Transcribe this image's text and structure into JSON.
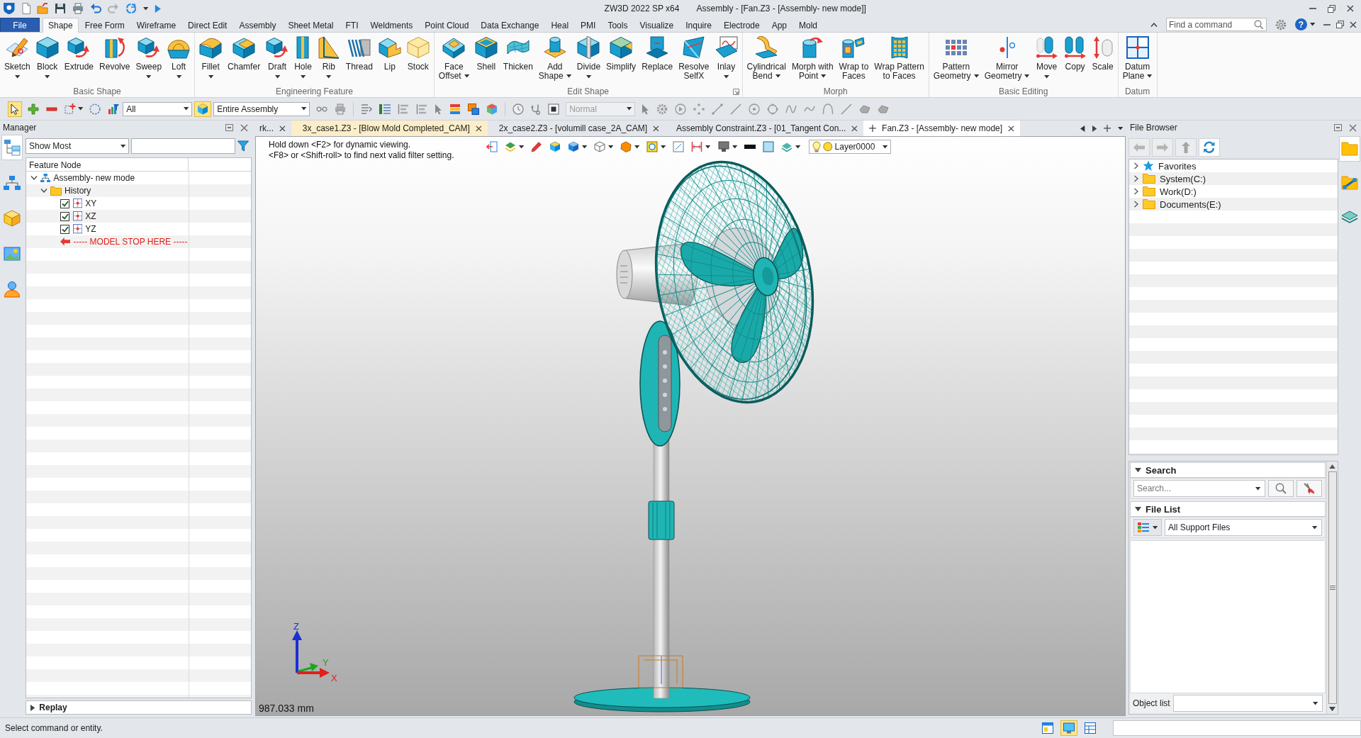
{
  "title_bar": {
    "app_name": "ZW3D 2022 SP x64",
    "document_title": "Assembly - [Fan.Z3 - [Assembly- new mode]]"
  },
  "menu_tabs": [
    {
      "label": "File",
      "kind": "file",
      "selected": false
    },
    {
      "label": "Shape",
      "kind": "tab",
      "selected": true
    },
    {
      "label": "Free Form",
      "kind": "tab",
      "selected": false
    },
    {
      "label": "Wireframe",
      "kind": "tab",
      "selected": false
    },
    {
      "label": "Direct Edit",
      "kind": "tab",
      "selected": false
    },
    {
      "label": "Assembly",
      "kind": "tab",
      "selected": false
    },
    {
      "label": "Sheet Metal",
      "kind": "tab",
      "selected": false
    },
    {
      "label": "FTI",
      "kind": "tab",
      "selected": false
    },
    {
      "label": "Weldments",
      "kind": "tab",
      "selected": false
    },
    {
      "label": "Point Cloud",
      "kind": "tab",
      "selected": false
    },
    {
      "label": "Data Exchange",
      "kind": "tab",
      "selected": false
    },
    {
      "label": "Heal",
      "kind": "tab",
      "selected": false
    },
    {
      "label": "PMI",
      "kind": "tab",
      "selected": false
    },
    {
      "label": "Tools",
      "kind": "tab",
      "selected": false
    },
    {
      "label": "Visualize",
      "kind": "tab",
      "selected": false
    },
    {
      "label": "Inquire",
      "kind": "tab",
      "selected": false
    },
    {
      "label": "Electrode",
      "kind": "tab",
      "selected": false
    },
    {
      "label": "App",
      "kind": "tab",
      "selected": false
    },
    {
      "label": "Mold",
      "kind": "tab",
      "selected": false
    }
  ],
  "command_search": {
    "placeholder": "Find a command"
  },
  "help_button": {
    "symbol": "?"
  },
  "ribbon_groups": [
    {
      "title": "Basic Shape",
      "launcher": false,
      "buttons": [
        {
          "lines": [
            "Sketch"
          ],
          "dropdown": true
        },
        {
          "lines": [
            "Block"
          ],
          "dropdown": true
        },
        {
          "lines": [
            "Extrude"
          ],
          "dropdown": false
        },
        {
          "lines": [
            "Revolve"
          ],
          "dropdown": false
        },
        {
          "lines": [
            "Sweep"
          ],
          "dropdown": true
        },
        {
          "lines": [
            "Loft"
          ],
          "dropdown": true
        }
      ]
    },
    {
      "title": "Engineering Feature",
      "launcher": false,
      "buttons": [
        {
          "lines": [
            "Fillet"
          ],
          "dropdown": true
        },
        {
          "lines": [
            "Chamfer"
          ],
          "dropdown": false
        },
        {
          "lines": [
            "Draft"
          ],
          "dropdown": true
        },
        {
          "lines": [
            "Hole"
          ],
          "dropdown": true
        },
        {
          "lines": [
            "Rib"
          ],
          "dropdown": true
        },
        {
          "lines": [
            "Thread"
          ],
          "dropdown": false
        },
        {
          "lines": [
            "Lip"
          ],
          "dropdown": false
        },
        {
          "lines": [
            "Stock"
          ],
          "dropdown": false
        }
      ]
    },
    {
      "title": "Edit Shape",
      "launcher": true,
      "buttons": [
        {
          "lines": [
            "Face",
            "Offset"
          ],
          "dropdown": true
        },
        {
          "lines": [
            "Shell"
          ],
          "dropdown": false
        },
        {
          "lines": [
            "Thicken"
          ],
          "dropdown": false
        },
        {
          "lines": [
            "Add",
            "Shape"
          ],
          "dropdown": true
        },
        {
          "lines": [
            "Divide"
          ],
          "dropdown": true
        },
        {
          "lines": [
            "Simplify"
          ],
          "dropdown": false
        },
        {
          "lines": [
            "Replace"
          ],
          "dropdown": false
        },
        {
          "lines": [
            "Resolve",
            "SelfX"
          ],
          "dropdown": false
        },
        {
          "lines": [
            "Inlay"
          ],
          "dropdown": true
        }
      ]
    },
    {
      "title": "Morph",
      "launcher": false,
      "buttons": [
        {
          "lines": [
            "Cylindrical",
            "Bend"
          ],
          "dropdown": true
        },
        {
          "lines": [
            "Morph with",
            "Point"
          ],
          "dropdown": true
        },
        {
          "lines": [
            "Wrap to",
            "Faces"
          ],
          "dropdown": false
        },
        {
          "lines": [
            "Wrap Pattern",
            "to Faces"
          ],
          "dropdown": false
        }
      ]
    },
    {
      "title": "Basic Editing",
      "launcher": false,
      "buttons": [
        {
          "lines": [
            "Pattern",
            "Geometry"
          ],
          "dropdown": true
        },
        {
          "lines": [
            "Mirror",
            "Geometry"
          ],
          "dropdown": true
        },
        {
          "lines": [
            "Move"
          ],
          "dropdown": true
        },
        {
          "lines": [
            "Copy"
          ],
          "dropdown": false
        },
        {
          "lines": [
            "Scale"
          ],
          "dropdown": false
        }
      ]
    },
    {
      "title": "Datum",
      "launcher": false,
      "buttons": [
        {
          "lines": [
            "Datum",
            "Plane"
          ],
          "dropdown": true
        }
      ]
    }
  ],
  "toolbar": {
    "select_active": true,
    "assembly_filter_active": true,
    "selection_filter": "All",
    "scope": "Entire Assembly",
    "display_mode": {
      "value": "Normal",
      "disabled": true
    }
  },
  "manager": {
    "title": "Manager",
    "dock_tabs": [
      {
        "selected": true
      },
      {
        "selected": false
      },
      {
        "selected": false
      },
      {
        "selected": false
      },
      {
        "selected": false
      }
    ],
    "filter": "Show Most",
    "column": "Feature Node",
    "tree": [
      {
        "label": "Assembly- new mode",
        "kind": "assembly",
        "expanded": true,
        "children": [
          {
            "label": "History",
            "kind": "folder",
            "expanded": true,
            "children": [
              {
                "label": "XY",
                "kind": "plane",
                "checked": true
              },
              {
                "label": "XZ",
                "kind": "plane",
                "checked": true
              },
              {
                "label": "YZ",
                "kind": "plane",
                "checked": true
              },
              {
                "label": "----- MODEL STOP HERE -----",
                "kind": "stop"
              }
            ]
          }
        ]
      }
    ],
    "replay": {
      "label": "Replay",
      "expanded": false
    }
  },
  "document_tabs": [
    {
      "label": "rk...",
      "selected": false,
      "highlighted": false
    },
    {
      "label": "3x_case1.Z3 - [Blow Mold Completed_CAM]",
      "selected": false,
      "highlighted": true
    },
    {
      "label": "2x_case2.Z3 - [volumill case_2A_CAM]",
      "selected": false,
      "highlighted": false
    },
    {
      "label": "Assembly Constraint.Z3 - [01_Tangent Con...",
      "selected": false,
      "highlighted": false
    },
    {
      "label": "Fan.Z3 - [Assembly- new mode]",
      "selected": true,
      "highlighted": false
    }
  ],
  "viewport": {
    "hints": [
      "Hold down <F2> for dynamic viewing.",
      "<F8> or <Shift-roll> to find next valid filter setting."
    ],
    "layer": "Layer0000",
    "axis_labels": [
      "Z",
      "Y",
      "X"
    ],
    "scale_readout": "987.033 mm"
  },
  "file_browser": {
    "title": "File Browser",
    "dock_tabs": [
      {
        "selected": true
      },
      {
        "selected": false
      },
      {
        "selected": false
      }
    ],
    "items": [
      {
        "label": "Favorites",
        "kind": "favorites",
        "expanded": false
      },
      {
        "label": "System(C:)",
        "kind": "drive",
        "expanded": false
      },
      {
        "label": "Work(D:)",
        "kind": "drive",
        "expanded": false
      },
      {
        "label": "Documents(E:)",
        "kind": "drive",
        "expanded": false
      }
    ],
    "search": {
      "title": "Search",
      "expanded": true,
      "placeholder": "Search..."
    },
    "file_list": {
      "title": "File List",
      "expanded": true,
      "filter": "All Support Files"
    },
    "object_list": {
      "label": "Object list"
    }
  },
  "status_bar": {
    "message": "Select command or entity.",
    "view_buttons": [
      {
        "selected": false
      },
      {
        "selected": true
      },
      {
        "selected": false
      }
    ]
  }
}
